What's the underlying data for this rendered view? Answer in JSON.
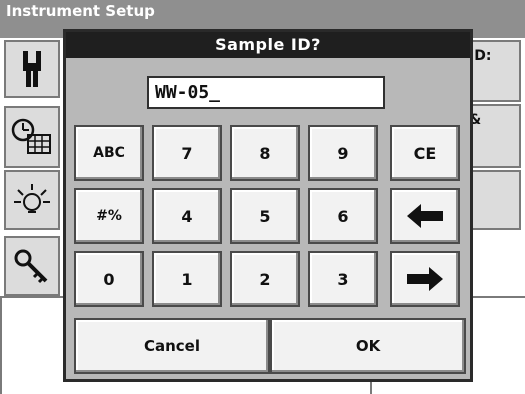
{
  "background": {
    "title": "Instrument Setup",
    "right_labels": [
      "ID:",
      "&"
    ],
    "tiles": [
      "tools-icon",
      "clock-calendar-icon",
      "lamp-icon",
      "key-icon"
    ]
  },
  "dialog": {
    "title": "Sample ID?",
    "entry_value": "WW-05_",
    "keys": [
      [
        "ABC",
        "7",
        "8",
        "9",
        "CE"
      ],
      [
        "#%",
        "4",
        "5",
        "6",
        "arrow-left-icon"
      ],
      [
        "0",
        "1",
        "2",
        "3",
        "arrow-right-icon"
      ]
    ],
    "cancel_label": "Cancel",
    "ok_label": "OK"
  }
}
